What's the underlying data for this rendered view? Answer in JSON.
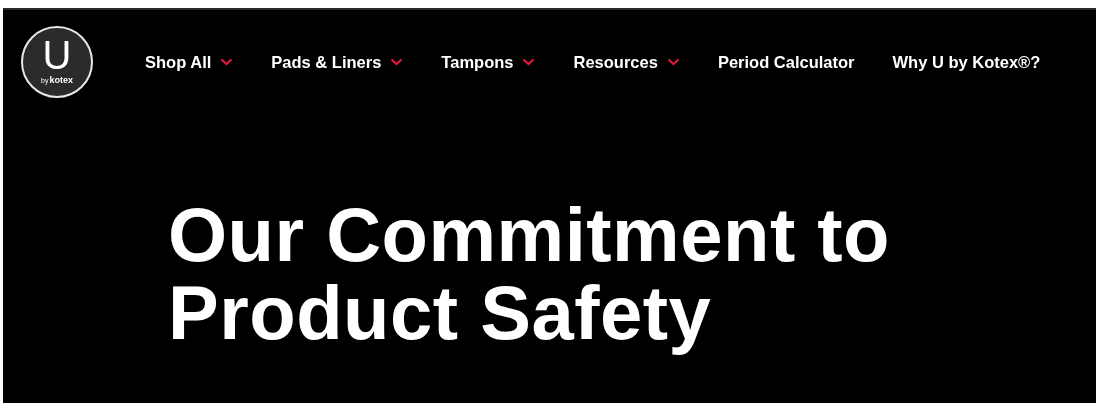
{
  "logo": {
    "letter": "U",
    "by": "by",
    "brand": "kotex"
  },
  "nav": [
    {
      "label": "Shop All",
      "has_dropdown": true
    },
    {
      "label": "Pads & Liners",
      "has_dropdown": true
    },
    {
      "label": "Tampons",
      "has_dropdown": true
    },
    {
      "label": "Resources",
      "has_dropdown": true
    },
    {
      "label": "Period Calculator",
      "has_dropdown": false
    },
    {
      "label": "Why U by Kotex®?",
      "has_dropdown": false
    }
  ],
  "hero": {
    "title_lines": [
      "Our Commitment to",
      "Product Safety"
    ]
  }
}
